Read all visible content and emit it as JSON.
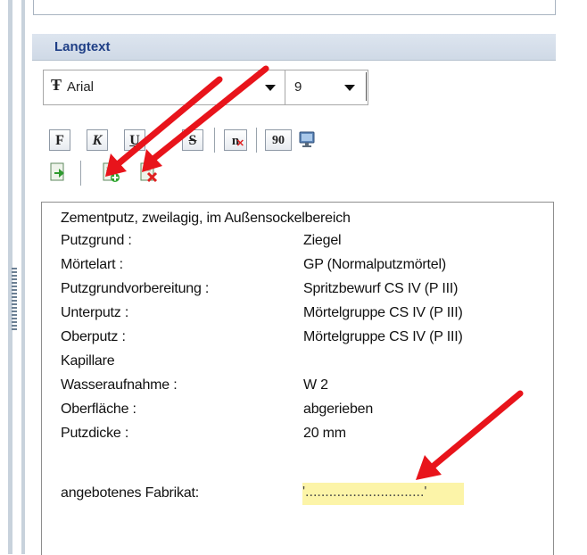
{
  "section": {
    "title": "Langtext"
  },
  "toolbar": {
    "font_icon": "Ŧ",
    "font_name": "Arial",
    "font_size": "9",
    "bold": "F",
    "italic": "K",
    "underline": "U",
    "strike": "S",
    "clear_format": "n",
    "rotate": "90"
  },
  "content": {
    "heading": "Zementputz, zweilagig, im Außensockelbereich",
    "rows": [
      {
        "label": "Putzgrund :",
        "value": "Ziegel"
      },
      {
        "label": "Mörtelart :",
        "value": "GP (Normalputzmörtel)"
      },
      {
        "label": "Putzgrundvorbereitung :",
        "value": "Spritzbewurf CS IV (P III)"
      },
      {
        "label": "Unterputz :",
        "value": "Mörtelgruppe CS IV (P III)"
      },
      {
        "label": "Oberputz :",
        "value": "Mörtelgruppe CS IV (P III)"
      },
      {
        "label": "Kapillare",
        "value": ""
      },
      {
        "label": "Wasseraufnahme :",
        "value": "W 2"
      },
      {
        "label": "Oberfläche :",
        "value": "abgerieben"
      },
      {
        "label": "Putzdicke :",
        "value": "20 mm"
      }
    ],
    "offered_label": "angebotenes Fabrikat:",
    "offered_value": "'..............................'"
  },
  "colors": {
    "annotation_arrow": "#e8141b",
    "field_highlight": "#fcf4a8",
    "section_title": "#1f3f86"
  }
}
